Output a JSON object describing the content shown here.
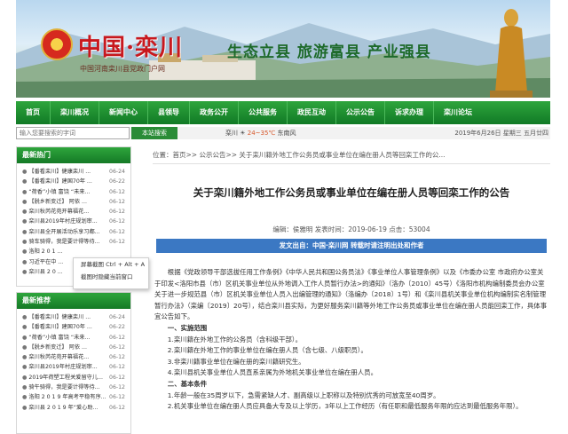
{
  "banner": {
    "site_name": "中国·栾川",
    "site_sub": "中国河南栾川县党政门户网",
    "slogan": "生态立县  旅游富县  产业强县"
  },
  "nav": {
    "items": [
      "首页",
      "栾川概况",
      "新闻中心",
      "县领导",
      "政务公开",
      "公共服务",
      "政民互动",
      "公示公告",
      "诉求办理",
      "栾川论坛"
    ]
  },
  "search": {
    "placeholder": "输入您要搜索的字词",
    "button_label": "本站搜索",
    "weather_city": "栾川",
    "weather_temp": "24~35℃",
    "weather_wind": "东南风",
    "date_text": "2019年6月26日 星期三  五月廿四"
  },
  "sidebar": {
    "hot_title": "最新热门",
    "hot_items": [
      {
        "text": "【番看栾川】健康栾川 ...",
        "date": "06-24"
      },
      {
        "text": "【番看栾川】建国70年 ...",
        "date": "06-22"
      },
      {
        "text": "“荷香”小镇 富饶 “未来...",
        "date": "06-12"
      },
      {
        "text": "【脱乡新变迁】 阿依 ...",
        "date": "06-12"
      },
      {
        "text": "栾川秋芮花苑开幕福花...",
        "date": "06-12"
      },
      {
        "text": "栾川县2019年村庄规划审...",
        "date": "06-12"
      },
      {
        "text": "栾川县全开展活动乐享习都...",
        "date": "06-12"
      },
      {
        "text": "骑车骑得，我是要计得等待...",
        "date": "06-12"
      },
      {
        "text": "洛阳 2 0 1 ...",
        "date": ""
      },
      {
        "text": "习近平在中 ...",
        "date": ""
      },
      {
        "text": "栾川县 2 0 ...",
        "date": ""
      }
    ],
    "rec_title": "最新推荐",
    "rec_items": [
      {
        "text": "【番看栾川】健康栾川 ...",
        "date": "06-24"
      },
      {
        "text": "【番看栾川】建国70年 ...",
        "date": "06-22"
      },
      {
        "text": "“荷香”小镇 富饶 “未来...",
        "date": "06-12"
      },
      {
        "text": "【脱乡新变迁】 阿依 ...",
        "date": "06-12"
      },
      {
        "text": "栾川秋芮花苑开幕福花...",
        "date": "06-12"
      },
      {
        "text": "栾川县2019年村庄规划审...",
        "date": "06-12"
      },
      {
        "text": "2019年荷塑工程关爱留守儿...",
        "date": "06-12"
      },
      {
        "text": "骑午骑得，我是要计得等待...",
        "date": "06-12"
      },
      {
        "text": "洛阳 2 0 1 9 年高考平稳有序...",
        "date": "06-12"
      },
      {
        "text": "栾川县 2 0 1 9 年“爱心助...",
        "date": "06-12"
      }
    ],
    "context_menu": [
      "屏幕截图 Ctrl + Alt + A",
      "截图时隐藏当前窗口"
    ]
  },
  "content": {
    "breadcrumb": "位置：首页>> 公示公告>> 关于栾川籍外地工作公务员或事业单位在编在册人员等回栾工作的公...",
    "title": "关于栾川籍外地工作公务员或事业单位在编在册人员等回栾工作的公告",
    "meta": "编辑：侯雅明  发表时间：2019-06-19  点击：53004",
    "source": "发文出自：中国·栾川网    转载时请注明出处和作者",
    "paragraphs": [
      {
        "cls": "",
        "text": "根据《党政领导干部选拔任用工作条例》《中华人民共和国公务员法》《事业单位人事管理条例》以及《市委办公室 市政府办公室关于印发<洛阳市县（市）区机关事业单位从外地调入工作人员暂行办法>的通知》（洛办〔2010〕45号）《洛阳市机构编制委员会办公室关于进一步规范县（市）区机关事业单位人员入出编管理的通知》（洛编办〔2018〕1号）和《栾川县机关事业单位机构编制实名制管理暂行办法》（栾编〔2019〕20号），结合栾川县实际，为更好服务栾川籍等外地工作公务员或事业单位在编在册人员能回栾工作，具体事宜公告如下。"
      },
      {
        "cls": "head noind",
        "text": "一、实施范围"
      },
      {
        "cls": "noind",
        "text": "1.栾川籍在外地工作的公务员（含科级干部）。"
      },
      {
        "cls": "noind",
        "text": "2.栾川籍在外地工作的事业单位在编在册人员（含七级、八级职员）。"
      },
      {
        "cls": "noind",
        "text": "3.非栾川籍事业单位在编在册的栾川籍研究生。"
      },
      {
        "cls": "noind",
        "text": "4.栾川县机关事业单位人员直系亲属为外地机关事业单位在编在册人员。"
      },
      {
        "cls": "head noind",
        "text": "二、基本条件"
      },
      {
        "cls": "noind",
        "text": "1.年龄一般在35周岁以下，急需紧缺人才、副高级以上职称以及特别优秀的可放宽至40周岁。"
      },
      {
        "cls": "noind",
        "text": "2.机关事业单位在编在册人员应具备大专及以上学历，3年以上工作经历（有任职和最低服务年限的应达到最低服务年限）。"
      }
    ]
  },
  "colors": {
    "nav_green": "#117a26",
    "source_blue": "#3b78c3",
    "site_red": "#c8181e"
  }
}
